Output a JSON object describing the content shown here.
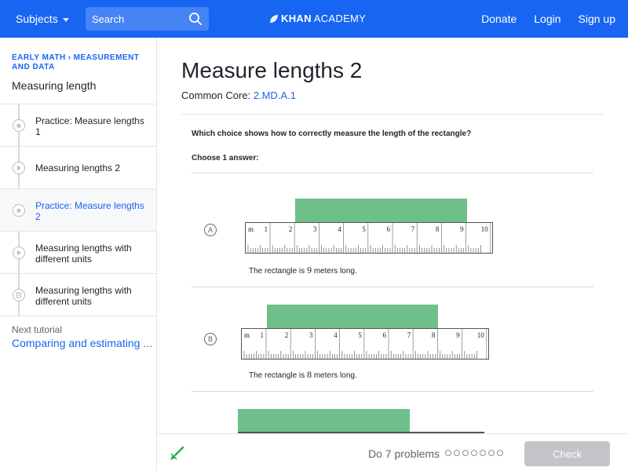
{
  "header": {
    "subjects_label": "Subjects",
    "search_placeholder": "Search",
    "logo_khan": "KHAN",
    "logo_academy": "ACADEMY",
    "nav": {
      "donate": "Donate",
      "login": "Login",
      "signup": "Sign up"
    },
    "brand_color": "#1865f2"
  },
  "sidebar": {
    "breadcrumb": {
      "course": "EARLY MATH",
      "unit": "MEASUREMENT AND DATA"
    },
    "unit_title": "Measuring length",
    "items": [
      {
        "label": "Practice: Measure lengths 1",
        "icon": "star-icon",
        "current": false
      },
      {
        "label": "Measuring lengths 2",
        "icon": "play-icon",
        "current": false
      },
      {
        "label": "Practice: Measure lengths 2",
        "icon": "star-icon",
        "current": true
      },
      {
        "label": "Measuring lengths with different units",
        "icon": "play-icon",
        "current": false
      },
      {
        "label": "Measuring lengths with different units",
        "icon": "article-icon",
        "current": false
      }
    ],
    "next_label": "Next tutorial",
    "next_link": "Comparing and estimating ..."
  },
  "main": {
    "title": "Measure lengths 2",
    "common_core_label": "Common Core:",
    "common_core_code": "2.MD.A.1",
    "question": "Which choice shows how to correctly measure the length of the rectangle?",
    "choose_label": "Choose 1 answer:",
    "ruler_unit": "m",
    "ruler_numbers": [
      "1",
      "2",
      "3",
      "4",
      "5",
      "6",
      "7",
      "8",
      "9",
      "10"
    ],
    "choices": [
      {
        "letter": "A",
        "caption_prefix": "The rectangle is",
        "caption_value": "9",
        "caption_suffix": "meters long."
      },
      {
        "letter": "B",
        "caption_prefix": "The rectangle is",
        "caption_value": "8",
        "caption_suffix": "meters long."
      }
    ]
  },
  "bottom": {
    "do_label": "Do 7 problems",
    "problem_count": 7,
    "check_label": "Check"
  }
}
